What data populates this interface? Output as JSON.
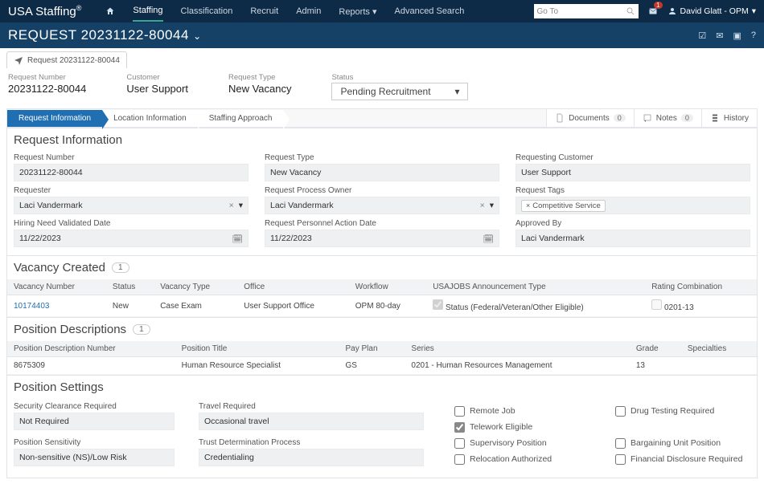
{
  "brand": "USA Staffing",
  "topnav": {
    "home": "home",
    "staffing": "Staffing",
    "classification": "Classification",
    "recruit": "Recruit",
    "admin": "Admin",
    "reports": "Reports",
    "advanced": "Advanced Search"
  },
  "goto_placeholder": "Go To",
  "mail_count": "1",
  "user_name": "David Glatt - OPM",
  "request_title": "REQUEST 20231122-80044",
  "tab_label": "Request 20231122-80044",
  "info": {
    "req_num_lbl": "Request Number",
    "req_num": "20231122-80044",
    "cust_lbl": "Customer",
    "cust": "User Support",
    "type_lbl": "Request Type",
    "type": "New Vacancy",
    "status_lbl": "Status",
    "status": "Pending Recruitment"
  },
  "wizard": {
    "s1": "Request Information",
    "s2": "Location Information",
    "s3": "Staffing Approach",
    "docs": "Documents",
    "docs_n": "0",
    "notes": "Notes",
    "notes_n": "0",
    "history": "History"
  },
  "sec1": {
    "title": "Request Information",
    "req_num_lbl": "Request Number",
    "req_num": "20231122-80044",
    "type_lbl": "Request Type",
    "type": "New Vacancy",
    "cust_lbl": "Requesting Customer",
    "cust": "User Support",
    "requester_lbl": "Requester",
    "requester": "Laci Vandermark",
    "rpo_lbl": "Request Process Owner",
    "rpo": "Laci Vandermark",
    "tags_lbl": "Request Tags",
    "tag": "Competitive Service",
    "hnvd_lbl": "Hiring Need Validated Date",
    "hnvd": "11/22/2023",
    "rpad_lbl": "Request Personnel Action Date",
    "rpad": "11/22/2023",
    "appr_lbl": "Approved By",
    "appr": "Laci Vandermark"
  },
  "sec2": {
    "title": "Vacancy Created",
    "count": "1",
    "h": {
      "vn": "Vacancy Number",
      "st": "Status",
      "vt": "Vacancy Type",
      "of": "Office",
      "wf": "Workflow",
      "at": "USAJOBS Announcement Type",
      "rc": "Rating Combination"
    },
    "r": {
      "vn": "10174403",
      "st": "New",
      "vt": "Case Exam",
      "of": "User Support Office",
      "wf": "OPM 80-day",
      "at": "Status (Federal/Veteran/Other Eligible)",
      "rc": "0201-13"
    }
  },
  "sec3": {
    "title": "Position Descriptions",
    "count": "1",
    "h": {
      "pdn": "Position Description Number",
      "pt": "Position Title",
      "pp": "Pay Plan",
      "se": "Series",
      "gr": "Grade",
      "sp": "Specialties"
    },
    "r": {
      "pdn": "8675309",
      "pt": "Human Resource Specialist",
      "pp": "GS",
      "se": "0201 - Human Resources Management",
      "gr": "13",
      "sp": ""
    }
  },
  "sec4": {
    "title": "Position Settings",
    "scr_lbl": "Security Clearance Required",
    "scr": "Not Required",
    "tr_lbl": "Travel Required",
    "tr": "Occasional travel",
    "ps_lbl": "Position Sensitivity",
    "ps": "Non-sensitive (NS)/Low Risk",
    "tdp_lbl": "Trust Determination Process",
    "tdp": "Credentialing",
    "remote": "Remote Job",
    "telework": "Telework Eligible",
    "supervisory": "Supervisory Position",
    "relocation": "Relocation Authorized",
    "drug": "Drug Testing Required",
    "bargain": "Bargaining Unit Position",
    "financial": "Financial Disclosure Required"
  }
}
